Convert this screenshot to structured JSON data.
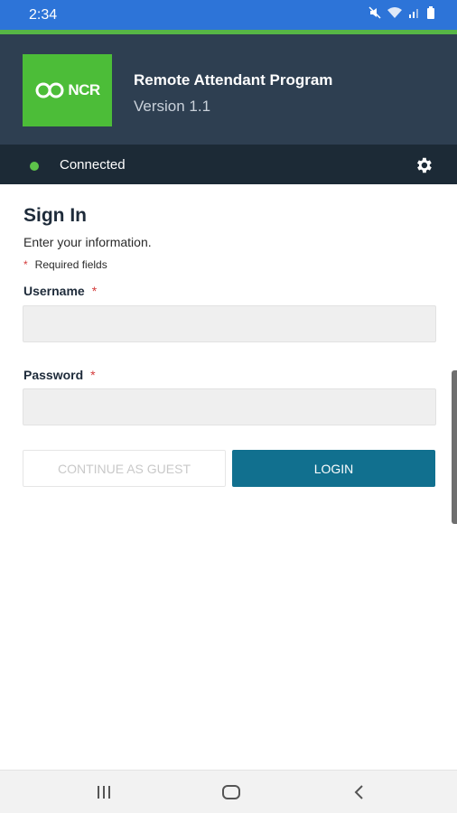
{
  "status_bar": {
    "time": "2:34",
    "icons": [
      "mute-icon",
      "wifi-icon",
      "signal-icon",
      "battery-icon"
    ]
  },
  "header": {
    "logo_text": "NCR",
    "app_title": "Remote Attendant Program",
    "version": "Version 1.1"
  },
  "connection": {
    "status": "Connected",
    "status_color": "#5dc24a",
    "settings_icon": "gear-icon"
  },
  "sign_in": {
    "title": "Sign In",
    "subtitle": "Enter your information.",
    "required_star": "*",
    "required_note": "Required fields",
    "username_label": "Username",
    "username_value": "",
    "password_label": "Password",
    "password_value": "",
    "guest_button": "CONTINUE AS GUEST",
    "login_button": "LOGIN"
  },
  "colors": {
    "status_bar": "#2d74d8",
    "header": "#2e3f51",
    "connection_bar": "#1c2a36",
    "logo_green": "#4cbd38",
    "login_button": "#11708f",
    "required_star": "#d43b3b"
  },
  "nav_bar": {
    "icons": [
      "recents-icon",
      "home-icon",
      "back-icon"
    ]
  }
}
